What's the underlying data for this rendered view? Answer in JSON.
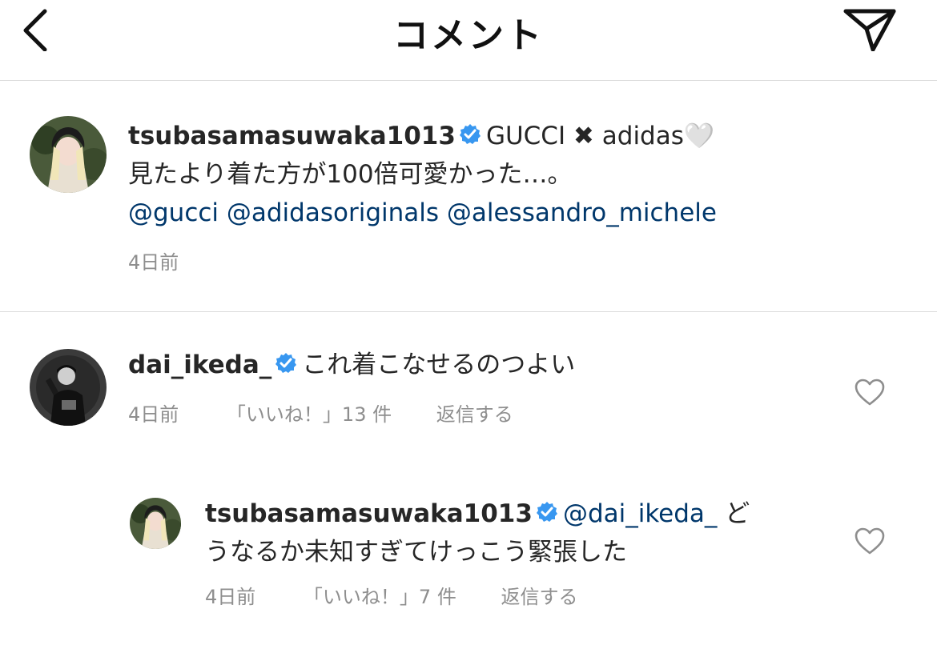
{
  "header": {
    "title": "コメント"
  },
  "caption": {
    "username": "tsubasamasuwaka1013",
    "text_line1": "GUCCI ✖ adidas🤍",
    "text_line2": "見たより着た方が100倍可愛かった…。",
    "mentions": "@gucci @adidasoriginals @alessandro_michele",
    "time": "4日前"
  },
  "comments": [
    {
      "username": "dai_ikeda_",
      "text": "これ着こなせるのつよい",
      "time": "4日前",
      "likes": "「いいね！」13 件",
      "reply": "返信する"
    }
  ],
  "replies": [
    {
      "username": "tsubasamasuwaka1013",
      "mention": "@dai_ikeda_",
      "text_part1": "ど",
      "text_part2": "うなるか未知すぎてけっこう緊張した",
      "time": "4日前",
      "likes": "「いいね！」7 件",
      "reply": "返信する"
    }
  ],
  "colors": {
    "mention": "#00376b",
    "verified": "#3897f0",
    "meta": "#8e8e8e",
    "divider": "#dbdbdb"
  }
}
